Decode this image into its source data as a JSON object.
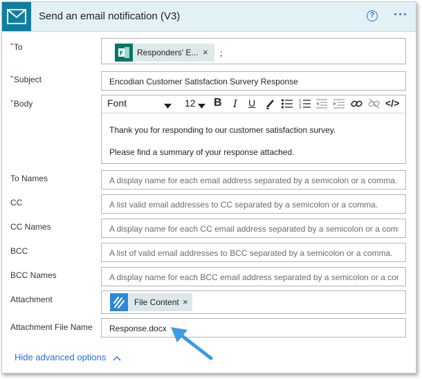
{
  "header": {
    "title": "Send an email notification (V3)",
    "help_glyph": "?",
    "more_glyph": "···",
    "icon": "envelope-icon",
    "accent": "#0f7ea3"
  },
  "fields": {
    "to": {
      "label": "To",
      "required_mark": "*",
      "token_label": "Responders' E...",
      "token_remove": "×",
      "separator": ";"
    },
    "subject": {
      "label": "Subject",
      "required_mark": "*",
      "value": "Encodian Customer Satisfaction Survery Response"
    },
    "body": {
      "label": "Body",
      "required_mark": "*",
      "font": "Font",
      "size": "12",
      "toolbar": {
        "bold": "B",
        "italic": "I",
        "underline": "U",
        "code": "</>"
      },
      "lines": [
        "Thank you for responding to our customer satisfaction survey.",
        "Please find a summary of your response attached."
      ]
    },
    "to_names": {
      "label": "To Names",
      "placeholder": "A display name for each email address separated by a semicolon or a comma."
    },
    "cc": {
      "label": "CC",
      "placeholder": "A list valid email addresses to CC separated by a semicolon or a comma."
    },
    "cc_names": {
      "label": "CC Names",
      "placeholder": "A display name for each CC email address separated by a semicolon or a comma"
    },
    "bcc": {
      "label": "BCC",
      "placeholder": "A list of valid email addresses to BCC separated by a semicolon or a comma."
    },
    "bcc_names": {
      "label": "BCC Names",
      "placeholder": "A display name for each BCC email address separated by a semicolon or a comma"
    },
    "attachment": {
      "label": "Attachment",
      "token_label": "File Content",
      "token_remove": "×"
    },
    "attachment_file_name": {
      "label": "Attachment File Name",
      "value": "Response.docx"
    }
  },
  "advanced": {
    "label": "Hide advanced options",
    "chevron": "chevron-up-icon"
  },
  "colors": {
    "link": "#2b6cd9",
    "required": "#c50f1f",
    "annotation_arrow": "#3d9be0"
  }
}
